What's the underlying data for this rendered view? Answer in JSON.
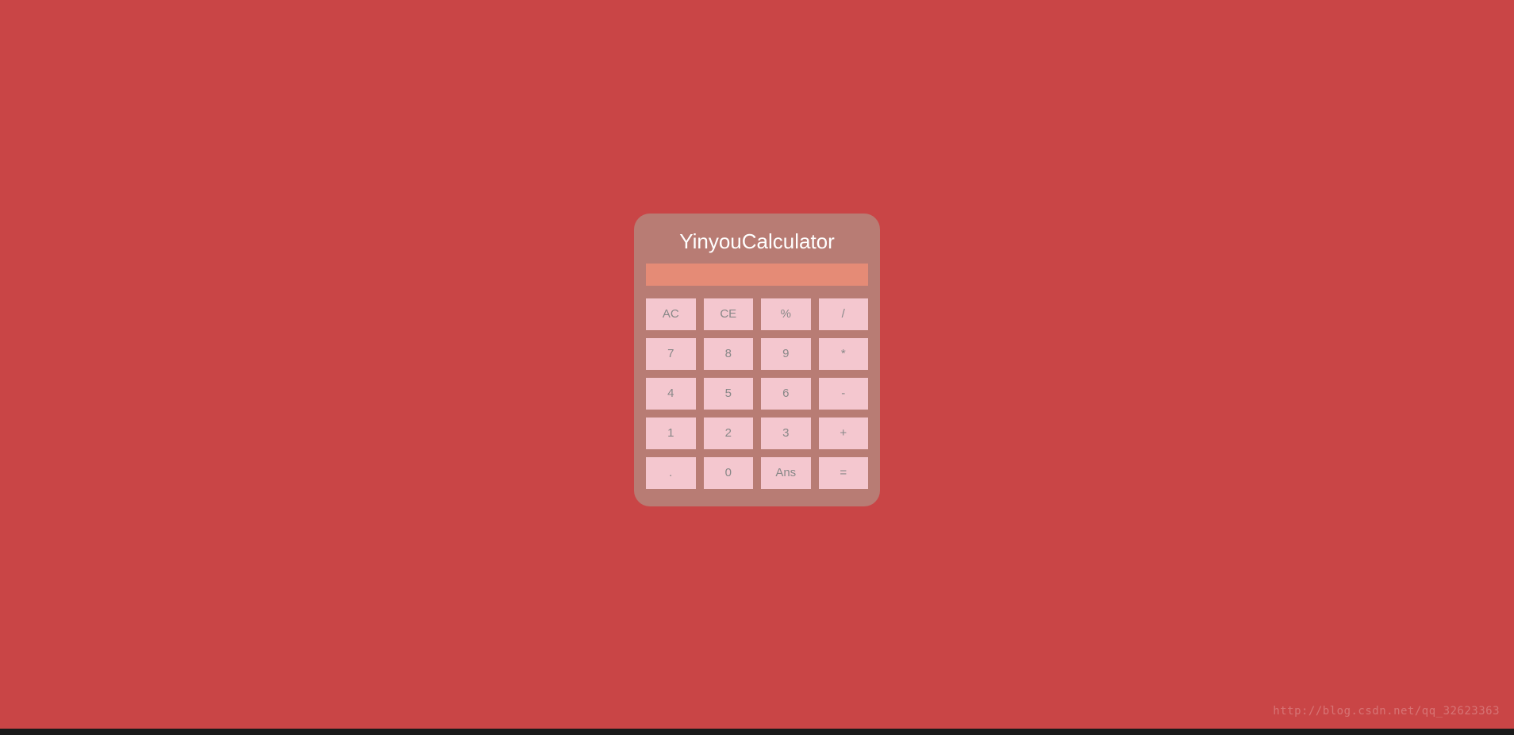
{
  "title": "YinyouCalculator",
  "display_value": "",
  "buttons": {
    "row0": [
      "AC",
      "CE",
      "%",
      "/"
    ],
    "row1": [
      "7",
      "8",
      "9",
      "*"
    ],
    "row2": [
      "4",
      "5",
      "6",
      "-"
    ],
    "row3": [
      "1",
      "2",
      "3",
      "+"
    ],
    "row4": [
      ".",
      "0",
      "Ans",
      "="
    ]
  },
  "watermark": "http://blog.csdn.net/qq_32623363"
}
